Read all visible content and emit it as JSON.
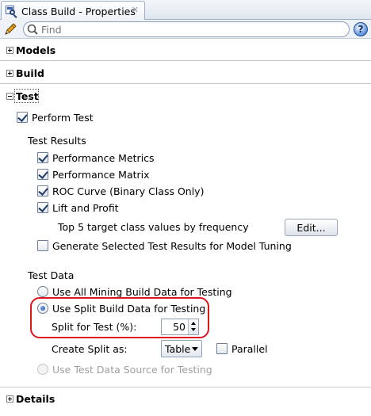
{
  "tab": {
    "title": "Class Build - Properties",
    "close": "✕"
  },
  "toolbar": {
    "search_placeholder": "Find",
    "help": "?"
  },
  "sections": {
    "models": {
      "label": "Models",
      "expanded": false
    },
    "build": {
      "label": "Build",
      "expanded": false
    },
    "test": {
      "label": "Test",
      "expanded": true
    },
    "details": {
      "label": "Details",
      "expanded": false
    }
  },
  "test": {
    "perform_test": {
      "label": "Perform Test",
      "checked": true
    },
    "results": {
      "heading": "Test Results",
      "performance_metrics": {
        "label": "Performance Metrics",
        "checked": true
      },
      "performance_matrix": {
        "label": "Performance Matrix",
        "checked": true
      },
      "roc_curve": {
        "label": "ROC Curve (Binary Class Only)",
        "checked": true
      },
      "lift_profit": {
        "label": "Lift and Profit",
        "checked": true
      },
      "top_target": {
        "label": "Top 5 target class values by frequency",
        "button": "Edit..."
      },
      "generate_selected": {
        "label": "Generate Selected Test Results for Model Tuning",
        "checked": false
      }
    },
    "data": {
      "heading": "Test Data",
      "use_all": {
        "label": "Use All Mining Build Data for Testing",
        "selected": false
      },
      "use_split": {
        "label": "Use Split Build Data for Testing",
        "selected": true
      },
      "split_for_test": {
        "label": "Split for Test (%):",
        "value": "50"
      },
      "create_split": {
        "label": "Create Split as:",
        "value": "Table"
      },
      "parallel": {
        "label": "Parallel",
        "checked": false
      },
      "use_source": {
        "label": "Use Test Data Source for Testing",
        "selected": false,
        "enabled": false
      }
    }
  },
  "colors": {
    "highlight": "#e0141e",
    "checkmark": "#1e3a66",
    "radio_selected": "#1f4f98"
  }
}
